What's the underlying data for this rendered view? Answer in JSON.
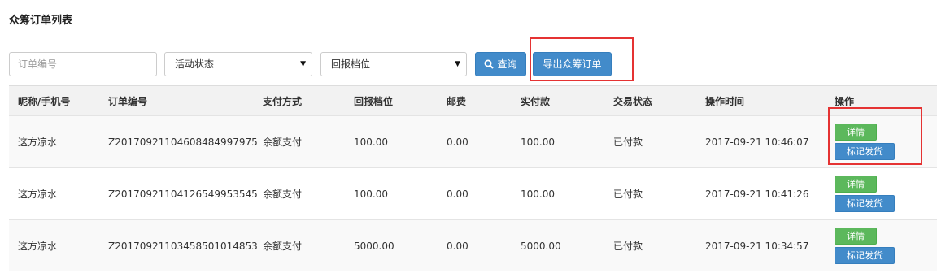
{
  "page": {
    "title": "众筹订单列表"
  },
  "filters": {
    "order_no_placeholder": "订单编号",
    "activity_status": "活动状态",
    "reward_tier": "回报档位",
    "query_label": "查询",
    "export_label": "导出众筹订单"
  },
  "table": {
    "headers": [
      "昵称/手机号",
      "订单编号",
      "支付方式",
      "回报档位",
      "邮费",
      "实付款",
      "交易状态",
      "操作时间",
      "操作"
    ],
    "rows": [
      {
        "nickname": "这方凉水",
        "order_no": "Z20170921104608484997975",
        "pay_method": "余额支付",
        "tier": "100.00",
        "postage": "0.00",
        "paid": "100.00",
        "status": "已付款",
        "time": "2017-09-21 10:46:07"
      },
      {
        "nickname": "这方凉水",
        "order_no": "Z20170921104126549953545",
        "pay_method": "余额支付",
        "tier": "100.00",
        "postage": "0.00",
        "paid": "100.00",
        "status": "已付款",
        "time": "2017-09-21 10:41:26"
      },
      {
        "nickname": "这方凉水",
        "order_no": "Z20170921103458501014853",
        "pay_method": "余额支付",
        "tier": "5000.00",
        "postage": "0.00",
        "paid": "5000.00",
        "status": "已付款",
        "time": "2017-09-21 10:34:57"
      }
    ],
    "detail_label": "详情",
    "ship_label": "标记发货"
  },
  "icons": [
    "search-icon",
    "caret-down-icon"
  ],
  "colors": {
    "primary": "#428bca",
    "success": "#5cb85c",
    "highlight": "#e53333",
    "header_bg": "#f2f2f2"
  }
}
